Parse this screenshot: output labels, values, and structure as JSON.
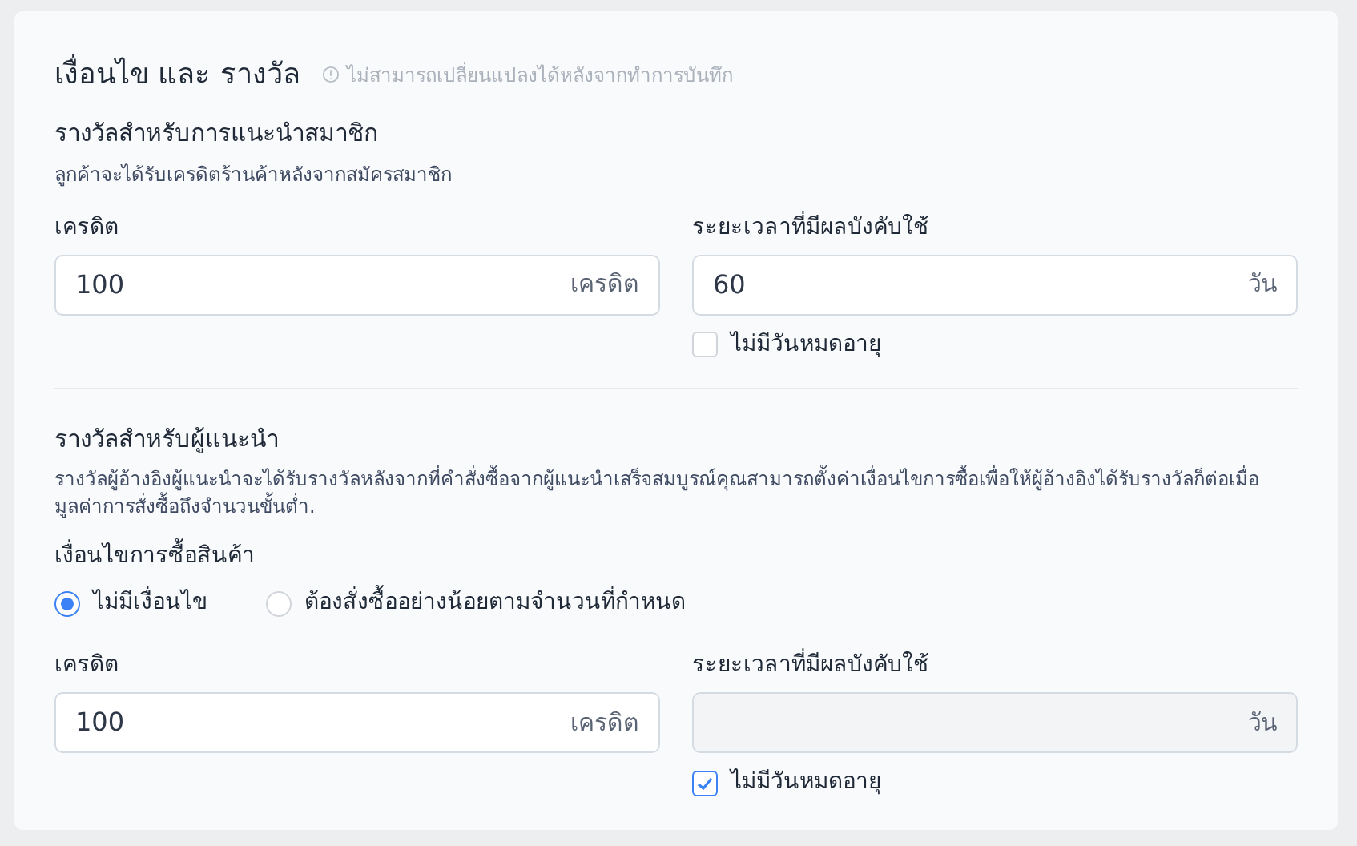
{
  "title": "เงื่อนไข และ รางวัล",
  "notice": "ไม่สามารถเปลี่ยนแปลงได้หลังจากทำการบันทึก",
  "sections": [
    {
      "heading": "รางวัลสำหรับการแนะนำสมาชิก",
      "description": "ลูกค้าจะได้รับเครดิตร้านค้าหลังจากสมัครสมาชิก",
      "credit": {
        "label": "เครดิต",
        "value": "100",
        "unit": "เครดิต"
      },
      "duration": {
        "label": "ระยะเวลาที่มีผลบังคับใช้",
        "value": "60",
        "unit": "วัน"
      },
      "no_expiry": {
        "label": "ไม่มีวันหมดอายุ",
        "checked": false
      }
    },
    {
      "heading": "รางวัลสำหรับผู้แนะนำ",
      "description": "รางวัลผู้อ้างอิงผู้แนะนำจะได้รับรางวัลหลังจากที่คำสั่งซื้อจากผู้แนะนำเสร็จสมบูรณ์คุณสามารถตั้งค่าเงื่อนไขการซื้อเพื่อให้ผู้อ้างอิงได้รับรางวัลก็ต่อเมื่อมูลค่าการสั่งซื้อถึงจำนวนขั้นต่ำ.",
      "condition": {
        "label": "เงื่อนไขการซื้อสินค้า",
        "options": [
          {
            "label": "ไม่มีเงื่อนไข",
            "selected": true
          },
          {
            "label": "ต้องสั่งซื้ออย่างน้อยตามจำนวนที่กำหนด",
            "selected": false
          }
        ]
      },
      "credit": {
        "label": "เครดิต",
        "value": "100",
        "unit": "เครดิต"
      },
      "duration": {
        "label": "ระยะเวลาที่มีผลบังคับใช้",
        "unit": "วัน"
      },
      "no_expiry": {
        "label": "ไม่มีวันหมดอายุ",
        "checked": true
      }
    }
  ]
}
